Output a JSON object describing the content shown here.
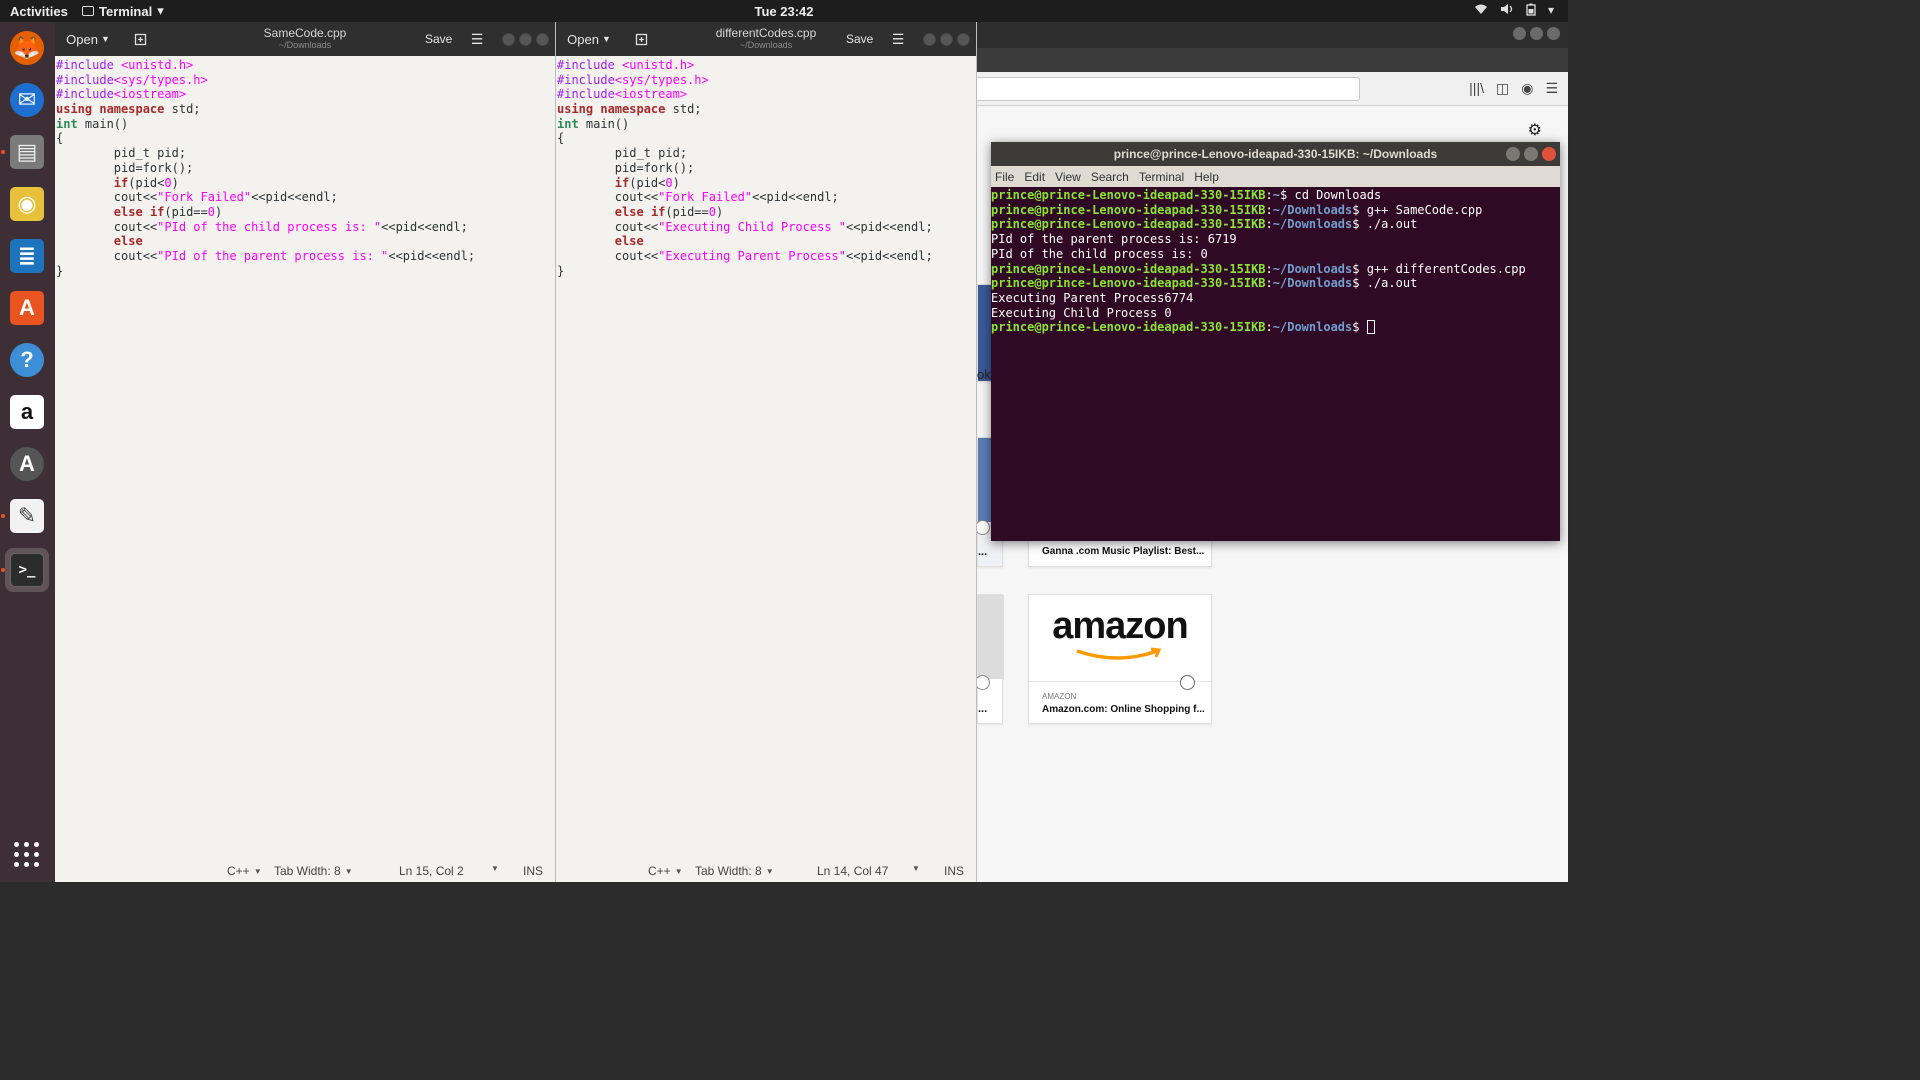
{
  "topbar": {
    "activities": "Activities",
    "app_name": "Terminal",
    "clock": "Tue 23:42"
  },
  "dock": {
    "items": [
      {
        "name": "firefox",
        "glyph": "🦊",
        "color": "#e66000",
        "running": false
      },
      {
        "name": "thunderbird",
        "glyph": "✉",
        "color": "#1f6fd0",
        "running": false
      },
      {
        "name": "files",
        "glyph": "▤",
        "color": "#7a7a7a",
        "running": true
      },
      {
        "name": "rhythmbox",
        "glyph": "◉",
        "color": "#e8c13c",
        "running": false
      },
      {
        "name": "libreoffice-writer",
        "glyph": "≣",
        "color": "#1e73be",
        "running": false
      },
      {
        "name": "software-center",
        "glyph": "A",
        "color": "#e95420",
        "running": false
      },
      {
        "name": "help",
        "glyph": "?",
        "color": "#3c8fd6",
        "running": false
      },
      {
        "name": "amazon",
        "glyph": "a",
        "color": "#ffffff",
        "running": false
      },
      {
        "name": "software-updater",
        "glyph": "A",
        "color": "#555555",
        "running": false
      },
      {
        "name": "text-editor",
        "glyph": "✎",
        "color": "#f2f2f2",
        "running": true
      },
      {
        "name": "terminal",
        "glyph": ">_",
        "color": "#2c2c2c",
        "running": true
      }
    ]
  },
  "editors": [
    {
      "id": "left",
      "open_label": "Open",
      "save_label": "Save",
      "title": "SameCode.cpp",
      "subtitle": "~/Downloads",
      "lines": [
        [
          [
            "pp",
            "#include "
          ],
          [
            "str",
            "<unistd.h>"
          ]
        ],
        [
          [
            "pp",
            "#include"
          ],
          [
            "str",
            "<sys/types.h>"
          ]
        ],
        [
          [
            "pp",
            "#include"
          ],
          [
            "str",
            "<iostream>"
          ]
        ],
        [
          [
            "kw",
            "using"
          ],
          [
            "n",
            " "
          ],
          [
            "kw",
            "namespace"
          ],
          [
            "n",
            " std;"
          ]
        ],
        [
          [
            "ty",
            "int"
          ],
          [
            "n",
            " main()"
          ]
        ],
        [
          [
            "n",
            "{"
          ]
        ],
        [
          [
            "n",
            "        pid_t pid;"
          ]
        ],
        [
          [
            "n",
            "        pid=fork();"
          ]
        ],
        [
          [
            "n",
            "        "
          ],
          [
            "kw",
            "if"
          ],
          [
            "n",
            "(pid<"
          ],
          [
            "num",
            "0"
          ],
          [
            "n",
            ")"
          ]
        ],
        [
          [
            "n",
            "        cout<<"
          ],
          [
            "str",
            "\"Fork Failed\""
          ],
          [
            "n",
            "<<pid<<endl;"
          ]
        ],
        [
          [
            "n",
            "        "
          ],
          [
            "kw",
            "else"
          ],
          [
            "n",
            " "
          ],
          [
            "kw",
            "if"
          ],
          [
            "n",
            "(pid=="
          ],
          [
            "num",
            "0"
          ],
          [
            "n",
            ")"
          ]
        ],
        [
          [
            "n",
            "        cout<<"
          ],
          [
            "str",
            "\"PId of the child process is: \""
          ],
          [
            "n",
            "<<pid<<endl;"
          ]
        ],
        [
          [
            "n",
            "        "
          ],
          [
            "kw",
            "else"
          ]
        ],
        [
          [
            "n",
            "        cout<<"
          ],
          [
            "str",
            "\"PId of the parent process is: \""
          ],
          [
            "n",
            "<<pid<<endl;"
          ]
        ],
        [
          [
            "n",
            "}"
          ]
        ]
      ],
      "status": {
        "language": "C++",
        "tab_width": "Tab Width: 8",
        "position": "Ln 15, Col 2",
        "mode": "INS"
      }
    },
    {
      "id": "right",
      "open_label": "Open",
      "save_label": "Save",
      "title": "differentCodes.cpp",
      "subtitle": "~/Downloads",
      "lines": [
        [
          [
            "pp",
            "#include "
          ],
          [
            "str",
            "<unistd.h>"
          ]
        ],
        [
          [
            "pp",
            "#include"
          ],
          [
            "str",
            "<sys/types.h>"
          ]
        ],
        [
          [
            "pp",
            "#include"
          ],
          [
            "str",
            "<iostream>"
          ]
        ],
        [
          [
            "kw",
            "using"
          ],
          [
            "n",
            " "
          ],
          [
            "kw",
            "namespace"
          ],
          [
            "n",
            " std;"
          ]
        ],
        [
          [
            "ty",
            "int"
          ],
          [
            "n",
            " main()"
          ]
        ],
        [
          [
            "n",
            "{"
          ]
        ],
        [
          [
            "n",
            "        pid_t pid;"
          ]
        ],
        [
          [
            "n",
            "        pid=fork();"
          ]
        ],
        [
          [
            "n",
            "        "
          ],
          [
            "kw",
            "if"
          ],
          [
            "n",
            "(pid<"
          ],
          [
            "num",
            "0"
          ],
          [
            "n",
            ")"
          ]
        ],
        [
          [
            "n",
            "        cout<<"
          ],
          [
            "str",
            "\"Fork Failed\""
          ],
          [
            "n",
            "<<pid<<endl;"
          ]
        ],
        [
          [
            "n",
            "        "
          ],
          [
            "kw",
            "else"
          ],
          [
            "n",
            " "
          ],
          [
            "kw",
            "if"
          ],
          [
            "n",
            "(pid=="
          ],
          [
            "num",
            "0"
          ],
          [
            "n",
            ")"
          ]
        ],
        [
          [
            "n",
            "        cout<<"
          ],
          [
            "str",
            "\"Executing Child Process \""
          ],
          [
            "n",
            "<<pid<<endl;"
          ]
        ],
        [
          [
            "n",
            "        "
          ],
          [
            "kw",
            "else"
          ]
        ],
        [
          [
            "n",
            "        cout<<"
          ],
          [
            "str",
            "\"Executing Parent Process\""
          ],
          [
            "n",
            "<<pid<<endl;"
          ]
        ],
        [
          [
            "n",
            "}"
          ]
        ]
      ],
      "status": {
        "language": "C++",
        "tab_width": "Tab Width: 8",
        "position": "Ln 14, Col 47",
        "mode": "INS"
      }
    }
  ],
  "terminal": {
    "title": "prince@prince-Lenovo-ideapad-330-15IKB: ~/Downloads",
    "menu": [
      "File",
      "Edit",
      "View",
      "Search",
      "Terminal",
      "Help"
    ],
    "lines": [
      {
        "user": "prince@prince-Lenovo-ideapad-330-15IKB",
        "path": "~",
        "cmd": " cd Downloads"
      },
      {
        "user": "prince@prince-Lenovo-ideapad-330-15IKB",
        "path": "~/Downloads",
        "cmd": " g++ SameCode.cpp"
      },
      {
        "user": "prince@prince-Lenovo-ideapad-330-15IKB",
        "path": "~/Downloads",
        "cmd": " ./a.out"
      },
      {
        "output": "PId of the parent process is: 6719"
      },
      {
        "output": "PId of the child process is: 0"
      },
      {
        "user": "prince@prince-Lenovo-ideapad-330-15IKB",
        "path": "~/Downloads",
        "cmd": " g++ differentCodes.cpp"
      },
      {
        "user": "prince@prince-Lenovo-ideapad-330-15IKB",
        "path": "~/Downloads",
        "cmd": " ./a.out"
      },
      {
        "output": "Executing Parent Process6774"
      },
      {
        "output": "Executing Child Process 0"
      },
      {
        "user": "prince@prince-Lenovo-ideapad-330-15IKB",
        "path": "~/Downloads",
        "cmd": " ",
        "cursor": true
      }
    ]
  },
  "browser": {
    "tile_ganna_caption": "Ganna .com Music Playlist: Best...",
    "tile_amazon_logo": "amazon",
    "tile_amazon_source": "AMAZON",
    "tile_amazon_caption": "Amazon.com: Online Shopping f...",
    "partial_text_ok": "ok",
    "partial_ellipsis_1": "...",
    "partial_ellipsis_2": "..."
  },
  "colors": {
    "terminal_bg": "#300a24",
    "prompt_user": "#8ae234",
    "prompt_path": "#729fcf",
    "preprocessor": "#a020f0",
    "keyword": "#a52a2a",
    "type": "#2e8b57",
    "string": "#ff00ff",
    "dock_bg": "#3d2f35"
  }
}
